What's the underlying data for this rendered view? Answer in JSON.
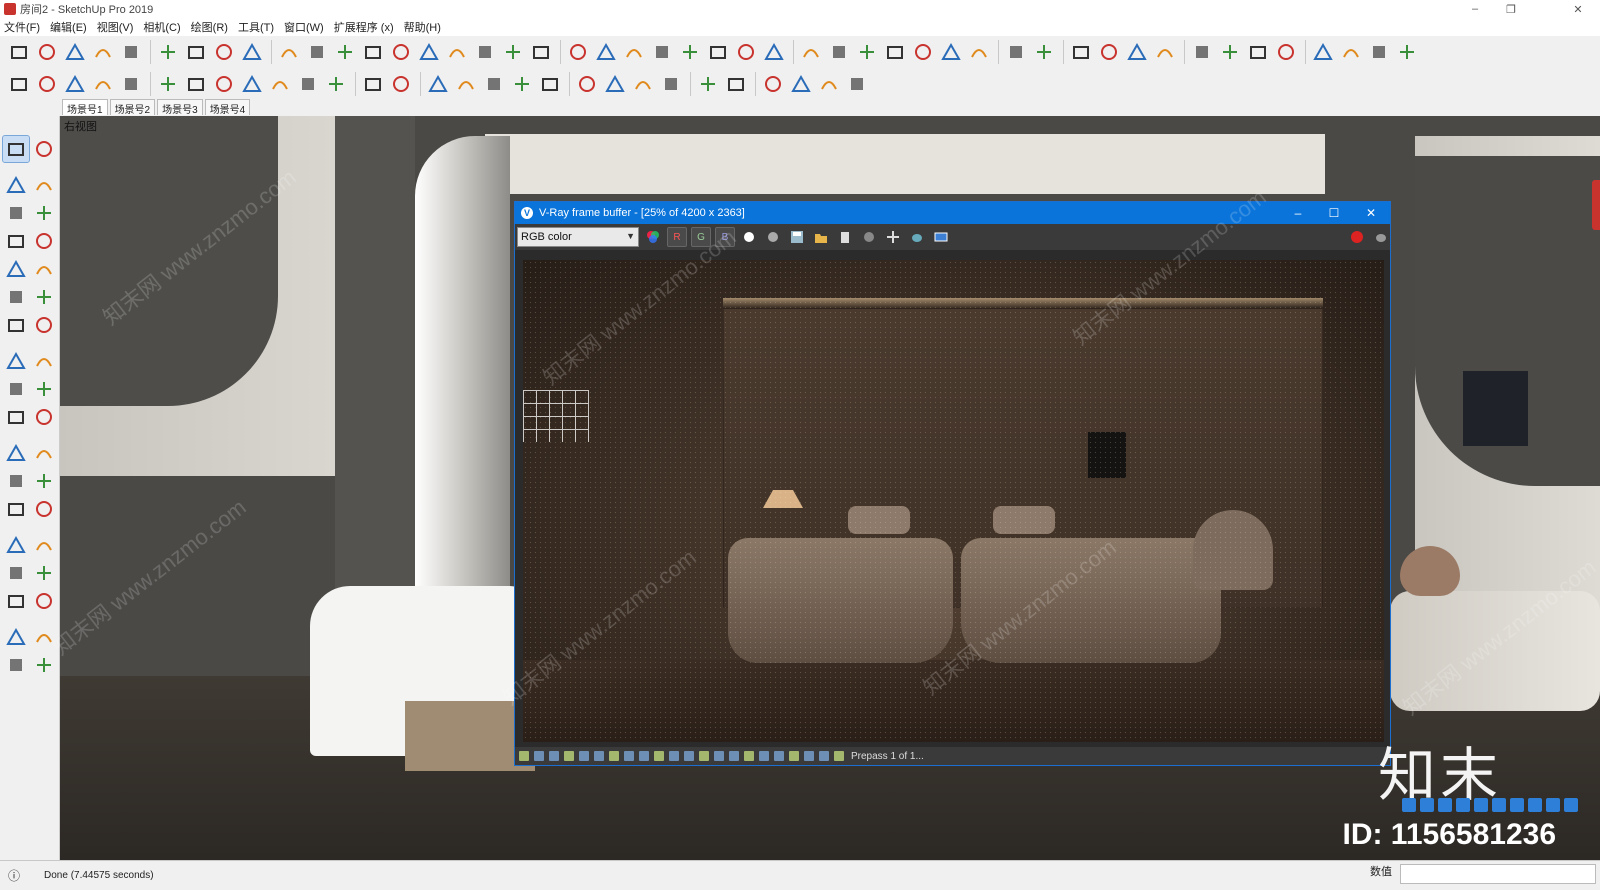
{
  "app": {
    "window_title": "房间2 - SketchUp Pro 2019",
    "window_controls": [
      "–",
      "❐",
      "✕"
    ]
  },
  "menu": [
    "文件(F)",
    "编辑(E)",
    "视图(V)",
    "相机(C)",
    "绘图(R)",
    "工具(T)",
    "窗口(W)",
    "扩展程序 (x)",
    "帮助(H)"
  ],
  "scenes": {
    "tabs": [
      "场景号1",
      "场景号2",
      "场景号3",
      "场景号4"
    ],
    "selected": 0
  },
  "viewport": {
    "view_label": "右视图"
  },
  "vray_window": {
    "title": "V-Ray frame buffer - [25% of 4200 x 2363]",
    "controls": [
      "–",
      "☐",
      "✕"
    ],
    "channel": "RGB color",
    "channel_buttons": [
      "R",
      "G",
      "B"
    ],
    "status": "Prepass 1 of 1..."
  },
  "statusbar": {
    "text": "Done (7.44575 seconds)",
    "measurement_label": "数值"
  },
  "watermark": {
    "text": "知末网 www.znzmo.com",
    "logo": "知末",
    "id": "ID: 1156581236"
  },
  "colors": {
    "vray_titlebar": "#0a74da",
    "sketchup_red": "#c8332e",
    "toolbar_bg": "#f0f0f0"
  },
  "icons": {
    "toolbar1": [
      "warehouse-icon",
      "box-icon",
      "component-icon",
      "sandbox-icon",
      "eraser-grid-icon",
      "tape-icon",
      "section-icon",
      "ruler-icon",
      "bar-chart-icon",
      "stair-icon",
      "beam-icon",
      "curve-icon",
      "path-icon",
      "arc-icon",
      "loop-icon",
      "join-icon",
      "flat-icon",
      "node-icon",
      "layer-icon",
      "fill-icon",
      "cube-icon",
      "cake-icon",
      "hat-icon",
      "wave-icon",
      "dish-icon",
      "swirl-icon",
      "chart-icon",
      "comb-icon",
      "columns-icon",
      "mirror-icon",
      "grid-icon",
      "block-icon",
      "pin-icon",
      "brush-icon",
      "record-icon",
      "clock-icon",
      "table-icon",
      "check-icon",
      "ring-char-icon",
      "mold-char-icon",
      "camera-icon",
      "move-icon",
      "iso-icon",
      "front-icon",
      "side-icon",
      "ball-icon",
      "sphere-icon",
      "clone-icon"
    ],
    "toolbar2": [
      "open-box-icon",
      "book-icon",
      "home-icon",
      "roof-icon",
      "shed-icon",
      "lamp-icon",
      "target-icon",
      "angle-icon",
      "pin-tool-icon",
      "sun-icon",
      "dome-icon",
      "circle-icon",
      "gem-icon",
      "gem-outline-icon",
      "face-icon",
      "face2-icon",
      "face3-icon",
      "layers-icon",
      "blue-box-icon",
      "vray-logo-icon",
      "teapot-icon",
      "teapot2-icon",
      "cloud-icon",
      "frame-icon",
      "frame2-icon",
      "window-icon",
      "window2-icon",
      "window3-icon",
      "lock-icon"
    ],
    "left_palette": [
      "select-arrow-icon",
      "component-make-icon",
      "paint-bucket-icon",
      "eraser-icon",
      "pencil-icon",
      "freehand-icon",
      "rectangle-icon",
      "rotated-rect-icon",
      "circle-tool-icon",
      "polygon-icon",
      "arc-tool-icon",
      "arc2-icon",
      "arc3-icon",
      "pie-icon",
      "move-tool-icon",
      "push-pull-icon",
      "rotate-icon",
      "follow-me-icon",
      "scale-icon",
      "offset-icon",
      "tape-tool-icon",
      "dimension-icon",
      "protractor-icon",
      "text-icon",
      "axes-icon",
      "3d-text-icon",
      "orbit-icon",
      "pan-icon",
      "zoom-icon",
      "zoom-window-icon",
      "zoom-extents-icon",
      "previous-view-icon",
      "position-camera-icon",
      "look-around-icon",
      "walk-icon",
      "section-plane-icon"
    ],
    "vray_toolbar": [
      "color-wheel-icon",
      "white-dot-icon",
      "grey-dot-icon",
      "save-icon",
      "folder-icon",
      "clipboard-icon",
      "circle-grey-icon",
      "crosshair-icon",
      "teapot-render-icon",
      "region-icon",
      "stop-icon",
      "teapot-interactive-icon"
    ]
  }
}
